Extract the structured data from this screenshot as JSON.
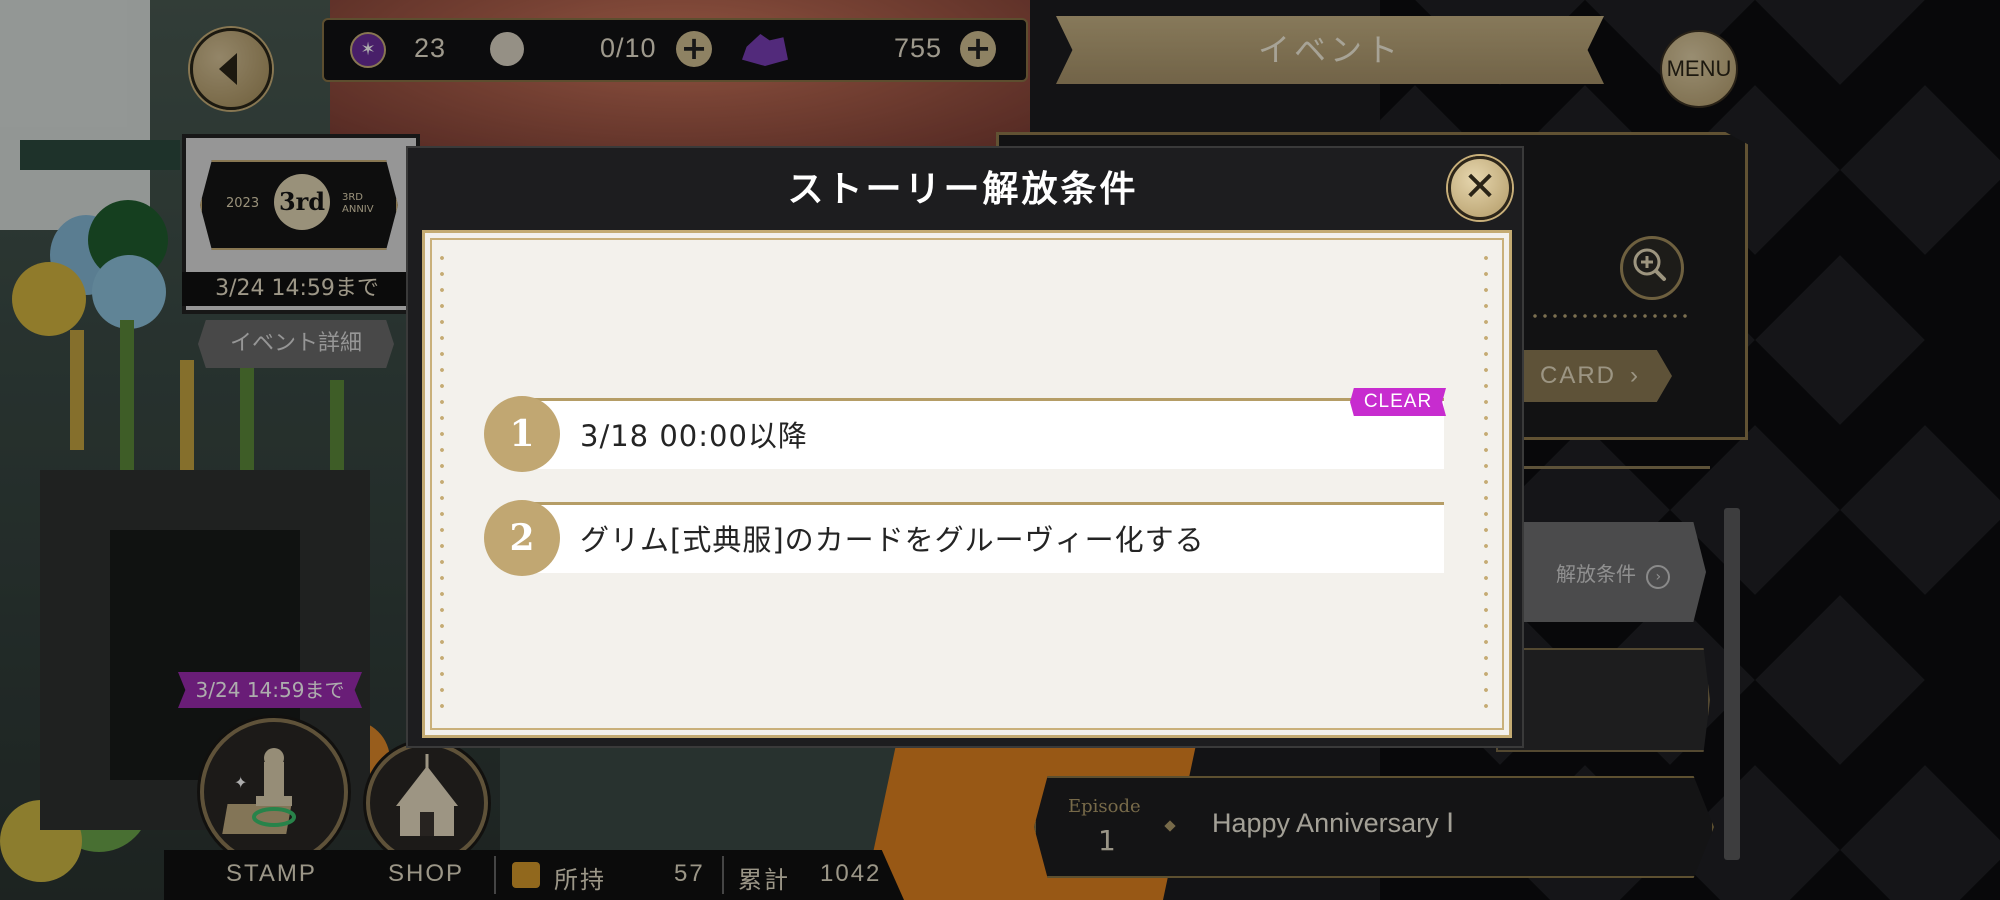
{
  "topbar": {
    "gems": "23",
    "stamina": "0/10",
    "crystals": "755",
    "event_title": "イベント",
    "menu_label": "MENU"
  },
  "left": {
    "event_logo_year": "2023",
    "event_logo_main": "3rd",
    "event_logo_sub": "3RD ANNIV",
    "event_deadline": "3/24 14:59まで",
    "event_detail_label": "イベント詳細",
    "stamp_deadline": "3/24 14:59まで",
    "stamp_label": "STAMP",
    "shop_label": "SHOP",
    "owned_label": "所持",
    "owned_value": "57",
    "total_label": "累計",
    "total_value": "1042"
  },
  "right": {
    "card_label": "CARD",
    "unlock_label": "解放条件",
    "episode_label": "Episode",
    "episode_num": "1",
    "episode_title": "Happy Anniversary Ⅰ"
  },
  "modal": {
    "title": "ストーリー解放条件",
    "clear_badge": "CLEAR",
    "conditions": [
      {
        "num": "1",
        "text": "3/18 00:00以降"
      },
      {
        "num": "2",
        "text": "グリム[式典服]のカードをグルーヴィー化する"
      }
    ]
  },
  "colors": {
    "gold": "#c1a772",
    "clear_magenta": "#c72ccf",
    "deadline_purple": "#9b2bb0"
  }
}
